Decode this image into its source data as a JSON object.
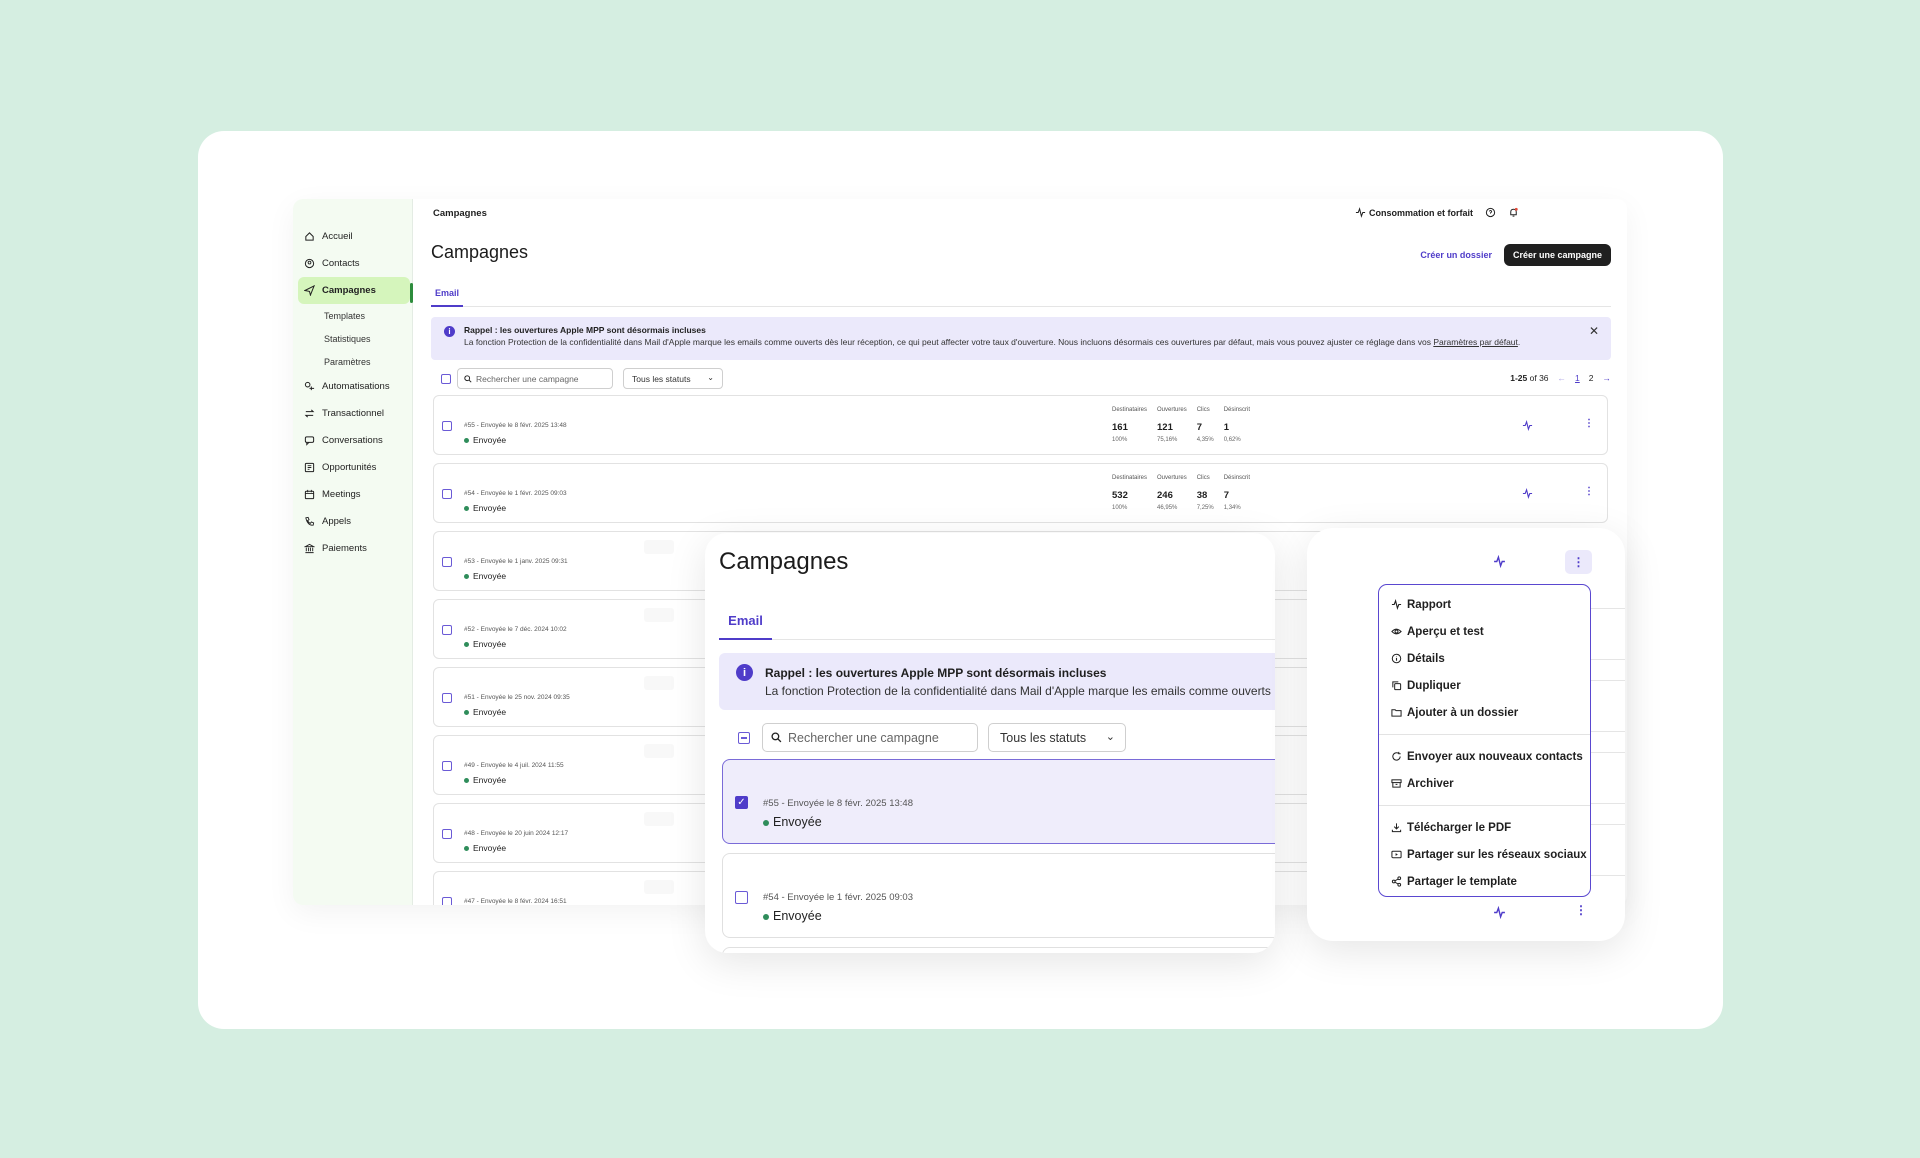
{
  "sidebar": {
    "items": [
      {
        "label": "Accueil",
        "icon": "home-icon"
      },
      {
        "label": "Contacts",
        "icon": "contacts-icon"
      },
      {
        "label": "Campagnes",
        "icon": "send-icon",
        "active": true
      },
      {
        "label": "Automatisations",
        "icon": "automation-icon"
      },
      {
        "label": "Transactionnel",
        "icon": "transactional-icon"
      },
      {
        "label": "Conversations",
        "icon": "chat-icon"
      },
      {
        "label": "Opportunités",
        "icon": "deals-icon"
      },
      {
        "label": "Meetings",
        "icon": "calendar-icon"
      },
      {
        "label": "Appels",
        "icon": "phone-icon"
      },
      {
        "label": "Paiements",
        "icon": "bank-icon"
      }
    ],
    "subitems": [
      "Templates",
      "Statistiques",
      "Paramètres"
    ]
  },
  "topbar": {
    "breadcrumb": "Campagnes",
    "usage_label": "Consommation et forfait"
  },
  "page": {
    "title": "Campagnes",
    "create_folder": "Créer un dossier",
    "create_campaign": "Créer une campagne",
    "tab_email": "Email"
  },
  "banner": {
    "title": "Rappel : les ouvertures Apple MPP sont désormais incluses",
    "text": "La fonction Protection de la confidentialité dans Mail d'Apple marque les emails comme ouverts dès leur réception, ce qui peut affecter votre taux d'ouverture. Nous incluons désormais ces ouvertures par défaut, mais vous pouvez ajuster ce réglage dans vos ",
    "link": "Paramètres par défaut",
    "text_end": ".",
    "zoom_text": "La fonction Protection de la confidentialité dans Mail d'Apple marque les emails comme ouverts"
  },
  "toolbar": {
    "search_placeholder": "Rechercher une campagne",
    "status_filter": "Tous les statuts",
    "range": "1-25",
    "of": "of 36",
    "page_1": "1",
    "page_2": "2"
  },
  "stat_labels": [
    "Destinataires",
    "Ouvertures",
    "Clics",
    "Désinscrit"
  ],
  "campaigns": [
    {
      "meta": "#55 - Envoyée le 8 févr. 2025 13:48",
      "status": "Envoyée",
      "stats": [
        {
          "v": "161",
          "p": "100%"
        },
        {
          "v": "121",
          "p": "75,16%"
        },
        {
          "v": "7",
          "p": "4,35%"
        },
        {
          "v": "1",
          "p": "0,62%"
        }
      ]
    },
    {
      "meta": "#54 - Envoyée le 1 févr. 2025 09:03",
      "status": "Envoyée",
      "stats": [
        {
          "v": "532",
          "p": "100%"
        },
        {
          "v": "246",
          "p": "46,95%"
        },
        {
          "v": "38",
          "p": "7,25%"
        },
        {
          "v": "7",
          "p": "1,34%"
        }
      ]
    },
    {
      "meta": "#53 - Envoyée le 1 janv. 2025 09:31",
      "status": "Envoyée"
    },
    {
      "meta": "#52 - Envoyée le 7 déc. 2024 10:02",
      "status": "Envoyée"
    },
    {
      "meta": "#51 - Envoyée le 25 nov. 2024 09:35",
      "status": "Envoyée"
    },
    {
      "meta": "#49 - Envoyée le 4 juil. 2024 11:55",
      "status": "Envoyée"
    },
    {
      "meta": "#48 - Envoyée le 20 juin 2024 12:17",
      "status": "Envoyée"
    },
    {
      "meta": "#47 - Envoyée le 8 févr. 2024 16:51",
      "status": ""
    }
  ],
  "zoom": {
    "title": "Campagnes",
    "tab": "Email",
    "row1_meta": "#55 - Envoyée le 8 févr. 2025 13:48",
    "row1_status": "Envoyée",
    "row2_meta": "#54 - Envoyée le 1 févr. 2025 09:03",
    "row2_status": "Envoyée"
  },
  "menu": {
    "group1": [
      {
        "label": "Rapport",
        "icon": "activity-icon"
      },
      {
        "label": "Aperçu et test",
        "icon": "eye-icon"
      },
      {
        "label": "Détails",
        "icon": "info-icon"
      },
      {
        "label": "Dupliquer",
        "icon": "copy-icon"
      },
      {
        "label": "Ajouter à un dossier",
        "icon": "folder-icon"
      }
    ],
    "group2": [
      {
        "label": "Envoyer aux nouveaux contacts",
        "icon": "refresh-icon"
      },
      {
        "label": "Archiver",
        "icon": "archive-icon"
      }
    ],
    "group3": [
      {
        "label": "Télécharger le PDF",
        "icon": "download-icon"
      },
      {
        "label": "Partager sur les réseaux sociaux",
        "icon": "share-screen-icon"
      },
      {
        "label": "Partager le template",
        "icon": "share-icon"
      }
    ]
  },
  "colors": {
    "background": "#d5eee1",
    "accent": "#4f3cc9",
    "sidebar_active": "#d5f5bc",
    "status_green": "#2f8d5b",
    "banner_bg": "#ebe9fb"
  }
}
